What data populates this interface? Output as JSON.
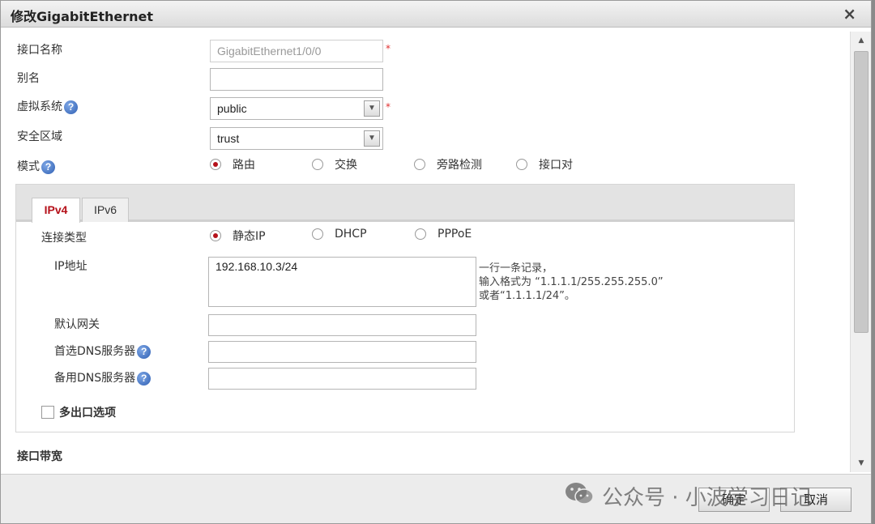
{
  "dialog": {
    "title": "修改GigabitEthernet",
    "close": "×"
  },
  "form": {
    "interface_name": {
      "label": "接口名称",
      "value": "GigabitEthernet1/0/0"
    },
    "alias": {
      "label": "别名",
      "value": ""
    },
    "vsys": {
      "label": "虚拟系统",
      "value": "public"
    },
    "zone": {
      "label": "安全区域",
      "value": "trust"
    },
    "mode": {
      "label": "模式",
      "options": [
        "路由",
        "交换",
        "旁路检测",
        "接口对"
      ],
      "selected": "路由"
    },
    "required_mark": "*"
  },
  "tabs": [
    {
      "label": "IPv4",
      "active": true
    },
    {
      "label": "IPv6",
      "active": false
    }
  ],
  "ipv4": {
    "conn_type": {
      "label": "连接类型",
      "options": [
        "静态IP",
        "DHCP",
        "PPPoE"
      ],
      "selected": "静态IP"
    },
    "ip": {
      "label": "IP地址",
      "value": "192.168.10.3/24"
    },
    "hint": [
      "一行一条记录，",
      "输入格式为 “1.1.1.1/255.255.255.0”",
      "或者“1.1.1.1/24”。"
    ],
    "gateway": {
      "label": "默认网关",
      "value": ""
    },
    "dns1": {
      "label": "首选DNS服务器",
      "value": ""
    },
    "dns2": {
      "label": "备用DNS服务器",
      "value": ""
    },
    "multi_exit": {
      "label": "多出口选项"
    }
  },
  "bandwidth": {
    "label": "接口带宽"
  },
  "footer": {
    "ok": "确定",
    "cancel": "取消",
    "watermark": "公众号 · 小波学习日记"
  },
  "icons": {
    "help": "?",
    "select_arrow": "▼",
    "scroll_up": "▲",
    "scroll_down": "▼"
  },
  "colors": {
    "accent": "#b5111a",
    "required": "#e03030"
  }
}
